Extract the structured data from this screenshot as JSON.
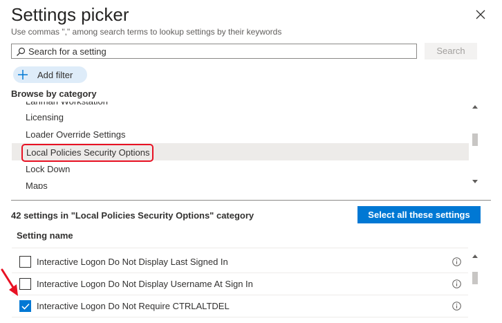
{
  "header": {
    "title": "Settings picker",
    "subtitle": "Use commas \",\" among search terms to lookup settings by their keywords"
  },
  "search": {
    "placeholder": "Search for a setting",
    "button_label": "Search"
  },
  "filter": {
    "add_label": "Add filter"
  },
  "browse": {
    "label": "Browse by category",
    "items": [
      {
        "label": "Lanman Workstation"
      },
      {
        "label": "Licensing"
      },
      {
        "label": "Loader Override Settings"
      },
      {
        "label": "Local Policies Security Options",
        "selected": true
      },
      {
        "label": "Lock Down"
      },
      {
        "label": "Maps"
      }
    ]
  },
  "settings": {
    "count_text": "42 settings in \"Local Policies Security Options\" category",
    "select_all_label": "Select all these settings",
    "column_header": "Setting name",
    "rows": [
      {
        "label": "Interactive Logon Do Not Display Last Signed In",
        "checked": false
      },
      {
        "label": "Interactive Logon Do Not Display Username At Sign In",
        "checked": false
      },
      {
        "label": "Interactive Logon Do Not Require CTRLALTDEL",
        "checked": true
      }
    ]
  },
  "colors": {
    "accent": "#0078d4",
    "highlight_border": "#e81123",
    "selected_row": "#edebe9",
    "filter_pill": "#deecf9"
  },
  "icons": {
    "close": "close-icon",
    "search": "search-icon",
    "add": "plus-icon",
    "info": "info-icon",
    "annotation": "red-arrow-icon"
  }
}
